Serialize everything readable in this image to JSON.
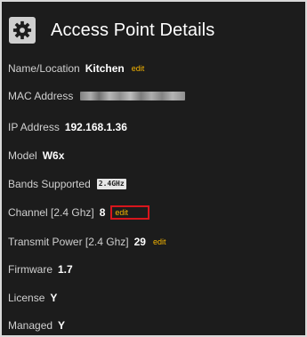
{
  "header": {
    "title": "Access Point Details",
    "icon": "gear-icon"
  },
  "details": {
    "name": {
      "label": "Name/Location",
      "value": "Kitchen",
      "edit": "edit"
    },
    "mac": {
      "label": "MAC Address"
    },
    "ip": {
      "label": "IP Address",
      "value": "192.168.1.36"
    },
    "model": {
      "label": "Model",
      "value": "W6x"
    },
    "bands": {
      "label": "Bands Supported",
      "badge": "2.4GHz"
    },
    "channel": {
      "label": "Channel [2.4 Ghz]",
      "value": "8",
      "edit": "edit"
    },
    "power": {
      "label": "Transmit Power [2.4 Ghz]",
      "value": "29",
      "edit": "edit"
    },
    "firmware": {
      "label": "Firmware",
      "value": "1.7"
    },
    "license": {
      "label": "License",
      "value": "Y"
    },
    "managed": {
      "label": "Managed",
      "value": "Y"
    }
  },
  "colors": {
    "background": "#1c1c1c",
    "edit_link": "#f5b400",
    "highlight": "#d8161c"
  }
}
